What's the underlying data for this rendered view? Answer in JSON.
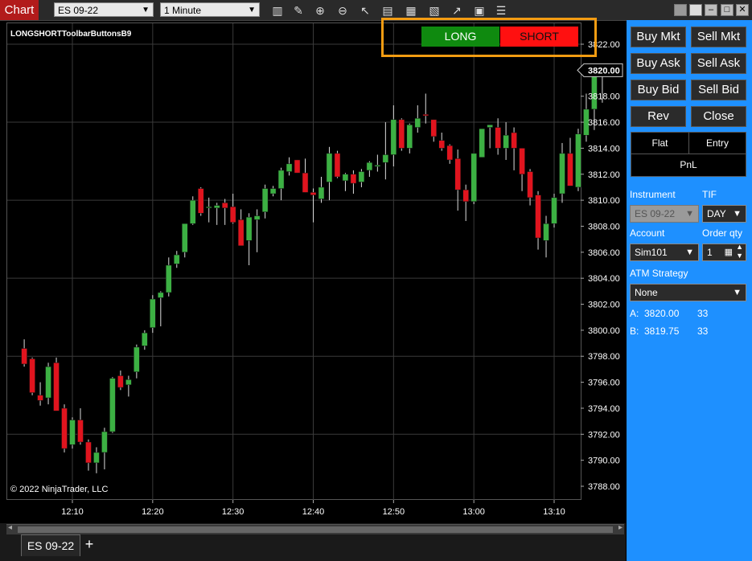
{
  "app": {
    "tab_label": "Chart"
  },
  "toolbar": {
    "instrument": "ES 09-22",
    "interval": "1 Minute",
    "tools": [
      "bars-icon",
      "pencil-icon",
      "zoom-in-icon",
      "zoom-out-icon",
      "cursor-icon",
      "data-box-icon",
      "layout-icon",
      "indicators-icon",
      "strategy-icon",
      "properties-icon",
      "menu-icon"
    ]
  },
  "chart": {
    "indicator_label": "LONGSHORTToolbarButtonsB9",
    "copyright": "© 2022 NinjaTrader, LLC",
    "long_label": "LONG",
    "short_label": "SHORT",
    "y_ticks": [
      "3822.00",
      "3820.00",
      "3818.00",
      "3816.00",
      "3814.00",
      "3812.00",
      "3810.00",
      "3808.00",
      "3806.00",
      "3804.00",
      "3802.00",
      "3800.00",
      "3798.00",
      "3796.00",
      "3794.00",
      "3792.00",
      "3790.00",
      "3788.00"
    ],
    "x_ticks": [
      "12:10",
      "12:20",
      "12:30",
      "12:40",
      "12:50",
      "13:00",
      "13:10"
    ],
    "last_price": "3820.00",
    "colors": {
      "up": "#3cb043",
      "down": "#e0141e",
      "grid": "#3a3a3a"
    }
  },
  "chart_data": {
    "type": "candlestick",
    "title": "ES 09-22",
    "xlabel": "",
    "ylabel": "",
    "ylim": [
      3787,
      3824
    ],
    "x_start": "12:04",
    "x_step_minutes": 1,
    "candles": [
      {
        "o": 3798.6,
        "h": 3799.3,
        "l": 3797.2,
        "c": 3797.4
      },
      {
        "o": 3797.8,
        "h": 3797.9,
        "l": 3795.0,
        "c": 3795.2
      },
      {
        "o": 3795.0,
        "h": 3796.0,
        "l": 3794.2,
        "c": 3794.6
      },
      {
        "o": 3794.8,
        "h": 3797.5,
        "l": 3794.3,
        "c": 3797.2
      },
      {
        "o": 3797.5,
        "h": 3797.9,
        "l": 3793.8,
        "c": 3793.8
      },
      {
        "o": 3794.0,
        "h": 3794.3,
        "l": 3790.6,
        "c": 3790.9
      },
      {
        "o": 3791.2,
        "h": 3793.3,
        "l": 3790.9,
        "c": 3793.1
      },
      {
        "o": 3793.1,
        "h": 3794.0,
        "l": 3791.2,
        "c": 3791.4
      },
      {
        "o": 3791.4,
        "h": 3791.6,
        "l": 3789.2,
        "c": 3789.8
      },
      {
        "o": 3789.8,
        "h": 3791.0,
        "l": 3789.0,
        "c": 3790.6
      },
      {
        "o": 3790.6,
        "h": 3792.5,
        "l": 3789.3,
        "c": 3792.2
      },
      {
        "o": 3792.2,
        "h": 3796.4,
        "l": 3792.1,
        "c": 3796.3
      },
      {
        "o": 3796.5,
        "h": 3796.9,
        "l": 3795.4,
        "c": 3795.6
      },
      {
        "o": 3795.8,
        "h": 3796.5,
        "l": 3794.9,
        "c": 3796.2
      },
      {
        "o": 3796.8,
        "h": 3798.9,
        "l": 3796.3,
        "c": 3798.7
      },
      {
        "o": 3798.8,
        "h": 3800.0,
        "l": 3798.5,
        "c": 3799.8
      },
      {
        "o": 3800.2,
        "h": 3802.7,
        "l": 3799.8,
        "c": 3802.4
      },
      {
        "o": 3802.5,
        "h": 3803.0,
        "l": 3800.3,
        "c": 3802.9
      },
      {
        "o": 3802.9,
        "h": 3805.6,
        "l": 3802.6,
        "c": 3805.0
      },
      {
        "o": 3805.1,
        "h": 3806.1,
        "l": 3804.8,
        "c": 3805.8
      },
      {
        "o": 3806.0,
        "h": 3808.1,
        "l": 3805.6,
        "c": 3808.2
      },
      {
        "o": 3808.2,
        "h": 3810.3,
        "l": 3808.1,
        "c": 3810.0
      },
      {
        "o": 3810.9,
        "h": 3811.0,
        "l": 3808.8,
        "c": 3809.0
      },
      {
        "o": 3809.5,
        "h": 3810.2,
        "l": 3808.3,
        "c": 3809.5
      },
      {
        "o": 3809.4,
        "h": 3809.8,
        "l": 3808.1,
        "c": 3809.6
      },
      {
        "o": 3809.8,
        "h": 3810.1,
        "l": 3808.1,
        "c": 3809.4
      },
      {
        "o": 3809.5,
        "h": 3810.5,
        "l": 3808.2,
        "c": 3808.3
      },
      {
        "o": 3808.5,
        "h": 3809.3,
        "l": 3806.5,
        "c": 3806.5
      },
      {
        "o": 3806.9,
        "h": 3809.0,
        "l": 3805.0,
        "c": 3808.7
      },
      {
        "o": 3808.5,
        "h": 3809.3,
        "l": 3806.0,
        "c": 3808.8
      },
      {
        "o": 3809.1,
        "h": 3811.2,
        "l": 3808.6,
        "c": 3810.9
      },
      {
        "o": 3810.5,
        "h": 3811.1,
        "l": 3810.3,
        "c": 3810.9
      },
      {
        "o": 3810.9,
        "h": 3812.5,
        "l": 3810.0,
        "c": 3812.3
      },
      {
        "o": 3812.2,
        "h": 3813.3,
        "l": 3811.9,
        "c": 3812.8
      },
      {
        "o": 3813.1,
        "h": 3812.3,
        "l": 3812.1,
        "c": 3812.1
      },
      {
        "o": 3812.1,
        "h": 3813.2,
        "l": 3810.8,
        "c": 3810.6
      },
      {
        "o": 3810.6,
        "h": 3810.9,
        "l": 3808.3,
        "c": 3810.4
      },
      {
        "o": 3810.1,
        "h": 3811.8,
        "l": 3809.8,
        "c": 3811.0
      },
      {
        "o": 3811.4,
        "h": 3814.1,
        "l": 3810.0,
        "c": 3813.6
      },
      {
        "o": 3813.6,
        "h": 3813.8,
        "l": 3811.7,
        "c": 3811.8
      },
      {
        "o": 3811.5,
        "h": 3812.1,
        "l": 3810.7,
        "c": 3812.0
      },
      {
        "o": 3812.0,
        "h": 3812.3,
        "l": 3810.5,
        "c": 3811.3
      },
      {
        "o": 3811.4,
        "h": 3812.4,
        "l": 3811.0,
        "c": 3812.2
      },
      {
        "o": 3812.3,
        "h": 3813.0,
        "l": 3811.8,
        "c": 3812.9
      },
      {
        "o": 3812.6,
        "h": 3813.5,
        "l": 3812.2,
        "c": 3812.7
      },
      {
        "o": 3812.9,
        "h": 3816.0,
        "l": 3811.6,
        "c": 3813.5
      },
      {
        "o": 3813.5,
        "h": 3817.3,
        "l": 3812.6,
        "c": 3816.2
      },
      {
        "o": 3816.2,
        "h": 3816.3,
        "l": 3813.8,
        "c": 3814.0
      },
      {
        "o": 3814.0,
        "h": 3815.9,
        "l": 3813.6,
        "c": 3815.8
      },
      {
        "o": 3815.6,
        "h": 3817.3,
        "l": 3815.2,
        "c": 3816.3
      },
      {
        "o": 3816.6,
        "h": 3818.2,
        "l": 3815.9,
        "c": 3816.5
      },
      {
        "o": 3816.2,
        "h": 3816.2,
        "l": 3814.5,
        "c": 3814.9
      },
      {
        "o": 3814.6,
        "h": 3815.2,
        "l": 3813.8,
        "c": 3814.0
      },
      {
        "o": 3814.2,
        "h": 3814.3,
        "l": 3812.8,
        "c": 3813.1
      },
      {
        "o": 3813.2,
        "h": 3813.9,
        "l": 3809.2,
        "c": 3810.8
      },
      {
        "o": 3810.8,
        "h": 3811.2,
        "l": 3808.4,
        "c": 3809.9
      },
      {
        "o": 3809.9,
        "h": 3813.6,
        "l": 3809.7,
        "c": 3813.6
      },
      {
        "o": 3813.3,
        "h": 3815.5,
        "l": 3813.3,
        "c": 3815.5
      },
      {
        "o": 3815.6,
        "h": 3815.8,
        "l": 3814.0,
        "c": 3815.8
      },
      {
        "o": 3815.6,
        "h": 3816.3,
        "l": 3813.5,
        "c": 3814.0
      },
      {
        "o": 3814.0,
        "h": 3816.0,
        "l": 3813.1,
        "c": 3815.0
      },
      {
        "o": 3815.2,
        "h": 3815.6,
        "l": 3812.3,
        "c": 3814.0
      },
      {
        "o": 3814.0,
        "h": 3813.6,
        "l": 3810.7,
        "c": 3812.0
      },
      {
        "o": 3812.2,
        "h": 3812.4,
        "l": 3809.6,
        "c": 3810.2
      },
      {
        "o": 3810.4,
        "h": 3810.7,
        "l": 3806.2,
        "c": 3807.1
      },
      {
        "o": 3806.9,
        "h": 3808.8,
        "l": 3805.6,
        "c": 3808.2
      },
      {
        "o": 3808.2,
        "h": 3810.5,
        "l": 3807.9,
        "c": 3810.2
      },
      {
        "o": 3810.5,
        "h": 3814.4,
        "l": 3809.8,
        "c": 3813.6
      },
      {
        "o": 3813.6,
        "h": 3814.8,
        "l": 3811.4,
        "c": 3811.1
      },
      {
        "o": 3811.0,
        "h": 3815.5,
        "l": 3810.7,
        "c": 3815.1
      },
      {
        "o": 3815.0,
        "h": 3818.2,
        "l": 3814.5,
        "c": 3817.0
      },
      {
        "o": 3817.0,
        "h": 3820.5,
        "l": 3815.4,
        "c": 3820.4
      },
      {
        "o": 3820.1,
        "h": 3820.5,
        "l": 3817.5,
        "c": 3819.8
      }
    ]
  },
  "side": {
    "buy_mkt": "Buy Mkt",
    "sell_mkt": "Sell Mkt",
    "buy_ask": "Buy Ask",
    "sell_ask": "Sell Ask",
    "buy_bid": "Buy Bid",
    "sell_bid": "Sell Bid",
    "rev": "Rev",
    "close": "Close",
    "flat": "Flat",
    "entry": "Entry",
    "pnl": "PnL",
    "instrument_label": "Instrument",
    "tif_label": "TIF",
    "instrument_value": "ES 09-22",
    "tif_value": "DAY",
    "account_label": "Account",
    "order_qty_label": "Order qty",
    "account_value": "Sim101",
    "order_qty_value": "1",
    "atm_label": "ATM Strategy",
    "atm_value": "None",
    "ask_label": "A:",
    "ask_price": "3820.00",
    "ask_size": "33",
    "bid_label": "B:",
    "bid_price": "3819.75",
    "bid_size": "33"
  },
  "tabs": {
    "active": "ES 09-22",
    "add": "+"
  }
}
